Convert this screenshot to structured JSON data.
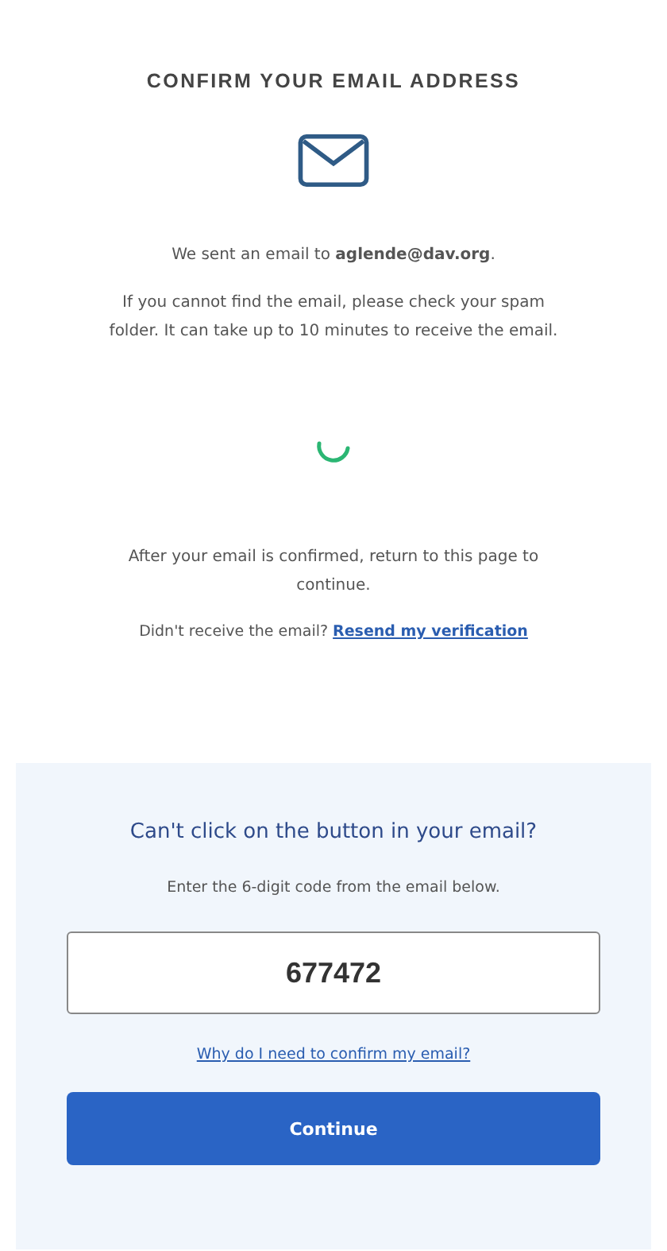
{
  "title": "CONFIRM YOUR EMAIL ADDRESS",
  "sent_message": "We sent an email to **aglende@dav.org**.",
  "help_text": "If you cannot find the email, please check your spam folder. It can take up to 10 minutes to receive the email.",
  "after_text": "After your email is confirmed, return to this page to continue.",
  "resend": {
    "prompt": "Didn't receive the email?",
    "link": "Resend my verification"
  },
  "code_panel": {
    "heading": "Can't click on the button in your email?",
    "instruction": "Enter the 6-digit code from the email below.",
    "code_value": "677472",
    "why_link": "Why do I need to confirm my email?",
    "button": "Continue"
  }
}
